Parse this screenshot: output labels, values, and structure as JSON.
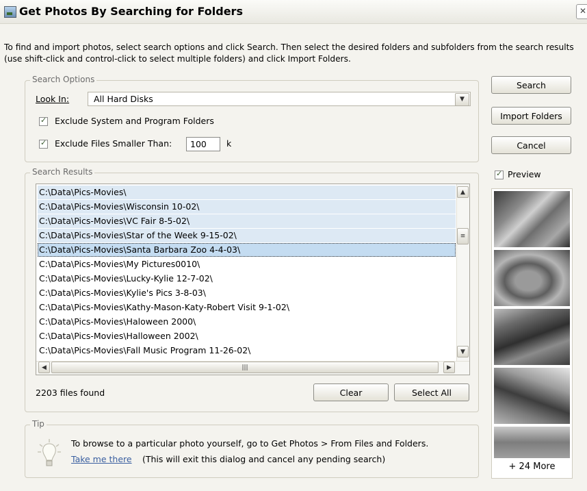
{
  "window": {
    "title": "Get Photos By Searching for Folders",
    "close_glyph": "✕"
  },
  "instructions": "To find and import photos, select search options and click Search. Then select the desired folders and subfolders from the search results (use shift-click and control-click to select multiple folders) and click Import Folders.",
  "search_options": {
    "group_label": "Search Options",
    "look_in_label": "Look In:",
    "look_in_value": "All Hard Disks",
    "exclude_system_label": "Exclude System and Program Folders",
    "exclude_system_checked": true,
    "exclude_small_label": "Exclude Files Smaller Than:",
    "exclude_small_checked": true,
    "min_size_value": "100",
    "min_size_unit": "k"
  },
  "buttons": {
    "search": "Search",
    "import_folders": "Import Folders",
    "cancel": "Cancel",
    "clear": "Clear",
    "select_all": "Select All"
  },
  "preview": {
    "label": "Preview",
    "checked": true,
    "more": "+ 24 More"
  },
  "search_results": {
    "group_label": "Search Results",
    "items": [
      "C:\\Data\\Pics-Movies\\",
      "C:\\Data\\Pics-Movies\\Wisconsin 10-02\\",
      "C:\\Data\\Pics-Movies\\VC Fair 8-5-02\\",
      "C:\\Data\\Pics-Movies\\Star of the Week 9-15-02\\",
      "C:\\Data\\Pics-Movies\\Santa Barbara Zoo 4-4-03\\",
      "C:\\Data\\Pics-Movies\\My Pictures0010\\",
      "C:\\Data\\Pics-Movies\\Lucky-Kylie 12-7-02\\",
      "C:\\Data\\Pics-Movies\\Kylie's Pics 3-8-03\\",
      "C:\\Data\\Pics-Movies\\Kathy-Mason-Katy-Robert Visit 9-1-02\\",
      "C:\\Data\\Pics-Movies\\Haloween 2000\\",
      "C:\\Data\\Pics-Movies\\Halloween 2002\\",
      "C:\\Data\\Pics-Movies\\Fall Music Program 11-26-02\\"
    ],
    "selected_count": 5,
    "focused_index": 4,
    "status": "2203 files found"
  },
  "tip": {
    "group_label": "Tip",
    "text": "To browse to a particular photo yourself, go to Get Photos > From Files and Folders.",
    "link": "Take me there",
    "link_note": "(This will exit this dialog and cancel any pending search)"
  }
}
